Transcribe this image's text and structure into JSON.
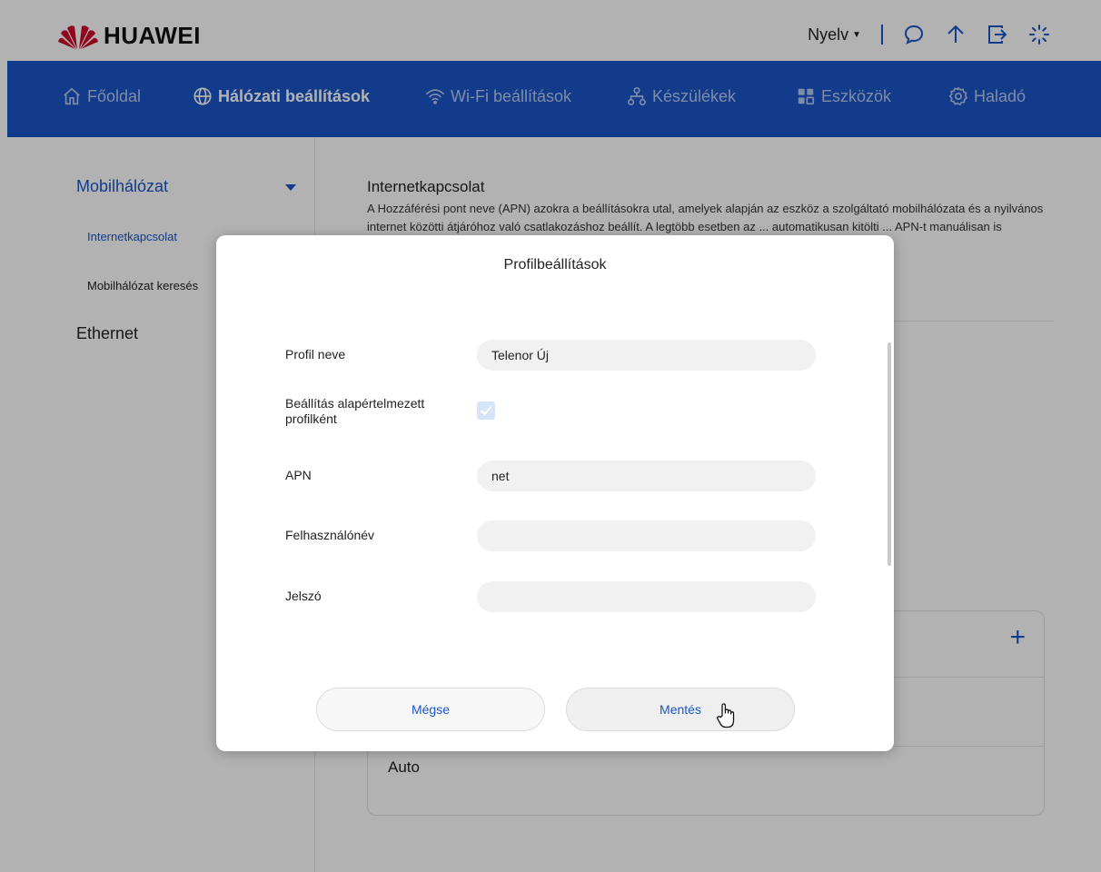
{
  "header": {
    "brand": "HUAWEI",
    "language": "Nyelv"
  },
  "nav": {
    "items": [
      {
        "label": "Főoldal",
        "icon": "home-icon",
        "active": false
      },
      {
        "label": "Hálózati beállítások",
        "icon": "globe-icon",
        "active": true
      },
      {
        "label": "Wi-Fi beállítások",
        "icon": "wifi-icon",
        "active": false
      },
      {
        "label": "Készülékek",
        "icon": "devices-icon",
        "active": false
      },
      {
        "label": "Eszközök",
        "icon": "tools-icon",
        "active": false
      },
      {
        "label": "Haladó",
        "icon": "settings-icon",
        "active": false
      }
    ]
  },
  "sidebar": {
    "group": "Mobilhálózat",
    "items": [
      {
        "label": "Internetkapcsolat",
        "active": true
      },
      {
        "label": "Mobilhálózat keresés",
        "active": false
      }
    ],
    "ethernet": "Ethernet"
  },
  "main": {
    "title": "Internetkapcsolat",
    "description": "A Hozzáférési pont neve (APN) azokra a beállításokra utal, amelyek alapján az eszköz a szolgáltató mobilhálózata és a nyilvános internet közötti átjáróhoz való csatlakozáshoz beállít. A legtöbb esetben az ... automatikusan kitölti ... APN-t manuálisan is",
    "apn_row": "Auto"
  },
  "modal": {
    "title": "Profilbeállítások",
    "fields": {
      "profile_name_label": "Profil neve",
      "profile_name_value": "Telenor Új",
      "default_label": "Beállítás alapértelmezett profilként",
      "default_checked": true,
      "apn_label": "APN",
      "apn_value": "net",
      "username_label": "Felhasználónév",
      "username_value": "",
      "password_label": "Jelszó",
      "password_value": ""
    },
    "cancel_label": "Mégse",
    "save_label": "Mentés"
  },
  "colors": {
    "brand_blue": "#1a55c8",
    "huawei_red": "#cf0a2c"
  }
}
